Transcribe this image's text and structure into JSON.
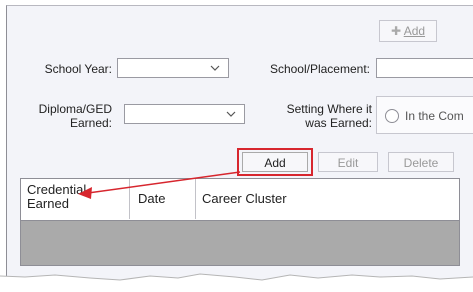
{
  "toolbar": {
    "add_label": "Add",
    "add_icon": "plus-icon"
  },
  "form": {
    "school_year_label": "School Year:",
    "school_year_value": "",
    "school_placement_label": "School/Placement:",
    "school_placement_value": "",
    "diploma_label_line1": "Diploma/GED",
    "diploma_label_line2": "Earned:",
    "diploma_value": "",
    "setting_label_line1": "Setting Where it",
    "setting_label_line2": "was Earned:",
    "setting_option": "In the Com"
  },
  "grid_toolbar": {
    "add_label": "Add",
    "edit_label": "Edit",
    "delete_label": "Delete"
  },
  "grid": {
    "columns": [
      {
        "line1": "Credential",
        "line2": "Earned"
      },
      {
        "line1": "Date",
        "line2": ""
      },
      {
        "line1": "Career Cluster",
        "line2": ""
      }
    ],
    "rows": []
  },
  "annotation": {
    "color": "#d7262e"
  }
}
